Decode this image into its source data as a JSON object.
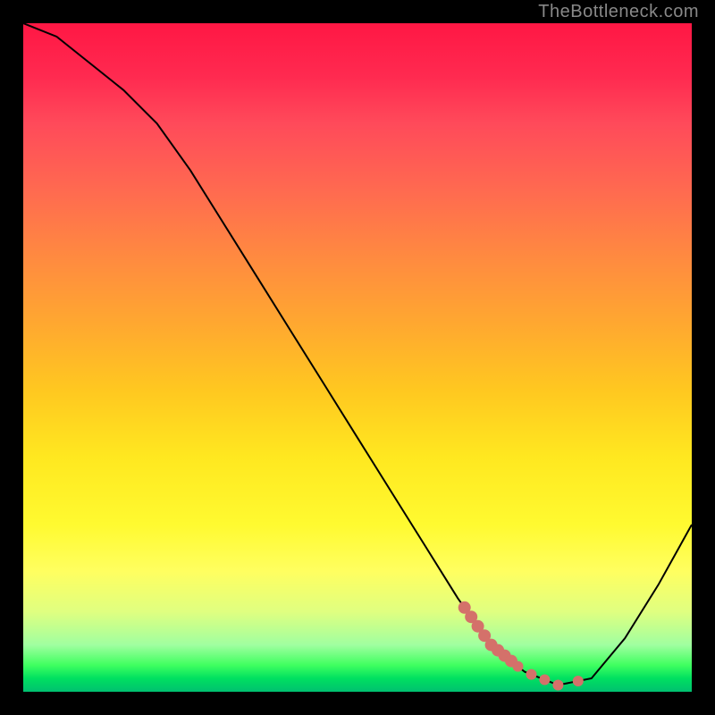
{
  "attribution": "TheBottleneck.com",
  "chart_data": {
    "type": "line",
    "title": "",
    "xlabel": "",
    "ylabel": "",
    "xlim": [
      0,
      100
    ],
    "ylim": [
      0,
      100
    ],
    "x": [
      0,
      5,
      10,
      15,
      20,
      25,
      30,
      35,
      40,
      45,
      50,
      55,
      60,
      65,
      70,
      75,
      80,
      85,
      90,
      95,
      100
    ],
    "values": [
      100,
      98,
      94,
      90,
      85,
      78,
      70,
      62,
      54,
      46,
      38,
      30,
      22,
      14,
      7,
      3,
      1,
      2,
      8,
      16,
      25
    ],
    "minimum_region_x": [
      65,
      84
    ],
    "highlight_points_x": [
      66,
      67,
      68,
      69,
      70,
      71,
      72,
      73,
      74,
      76,
      78,
      80,
      83
    ],
    "highlight_color": "#d4716a",
    "curve_color": "#000000",
    "background": "red-yellow-green vertical gradient (heatmap style, red=top/bad, green=bottom/good)"
  }
}
